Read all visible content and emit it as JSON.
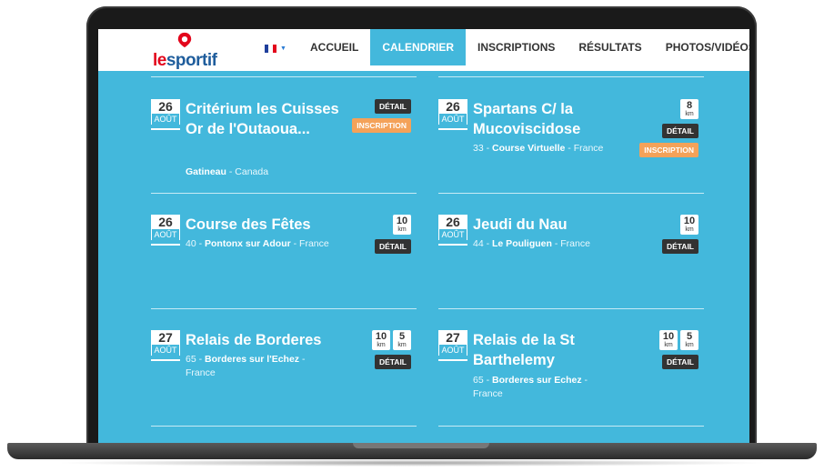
{
  "nav": {
    "logo_le": "le",
    "logo_rest": "sportif",
    "menu": [
      {
        "label": "ACCUEIL",
        "active": false
      },
      {
        "label": "CALENDRIER",
        "active": true
      },
      {
        "label": "INSCRIPTIONS",
        "active": false
      },
      {
        "label": "RÉSULTATS",
        "active": false
      },
      {
        "label": "PHOTOS/VIDÉOS",
        "active": false
      }
    ]
  },
  "events": [
    {
      "day": "26",
      "month": "AOÛT",
      "title": "Critérium les Cuisses Or de l'Outaoua...",
      "dept": "",
      "city": "Gatineau",
      "country": " - Canada",
      "kms": [],
      "detail": "DÉTAIL",
      "inscription": "INSCRIPTION"
    },
    {
      "day": "26",
      "month": "AOÛT",
      "title": "Spartans C/ la Mucoviscidose",
      "dept": "33 - ",
      "city": "Course Virtuelle",
      "country": " - France",
      "kms": [
        {
          "v": "8",
          "u": "km"
        }
      ],
      "detail": "DÉTAIL",
      "inscription": "INSCRIPTION"
    },
    {
      "day": "26",
      "month": "AOÛT",
      "title": "Course des Fêtes",
      "dept": "40 - ",
      "city": "Pontonx sur Adour",
      "country": " - France",
      "kms": [
        {
          "v": "10",
          "u": "km"
        }
      ],
      "detail": "DÉTAIL",
      "inscription": ""
    },
    {
      "day": "26",
      "month": "AOÛT",
      "title": "Jeudi du Nau",
      "dept": "44 - ",
      "city": "Le Pouliguen",
      "country": " - France",
      "kms": [
        {
          "v": "10",
          "u": "km"
        }
      ],
      "detail": "DÉTAIL",
      "inscription": ""
    },
    {
      "day": "27",
      "month": "AOÛT",
      "title": "Relais de Borderes",
      "dept": "65 - ",
      "city": "Borderes sur l'Echez",
      "country": " - France",
      "kms": [
        {
          "v": "10",
          "u": "km"
        },
        {
          "v": "5",
          "u": "km"
        }
      ],
      "detail": "DÉTAIL",
      "inscription": ""
    },
    {
      "day": "27",
      "month": "AOÛT",
      "title": "Relais de la St Barthelemy",
      "dept": "65 - ",
      "city": "Borderes sur Echez",
      "country": " - France",
      "kms": [
        {
          "v": "10",
          "u": "km"
        },
        {
          "v": "5",
          "u": "km"
        }
      ],
      "detail": "DÉTAIL",
      "inscription": ""
    }
  ],
  "colors": {
    "accent": "#43b8dc",
    "logo_red": "#e3061c",
    "logo_blue": "#1f5d9c",
    "inscription": "#f4a259",
    "detail": "#333333"
  }
}
